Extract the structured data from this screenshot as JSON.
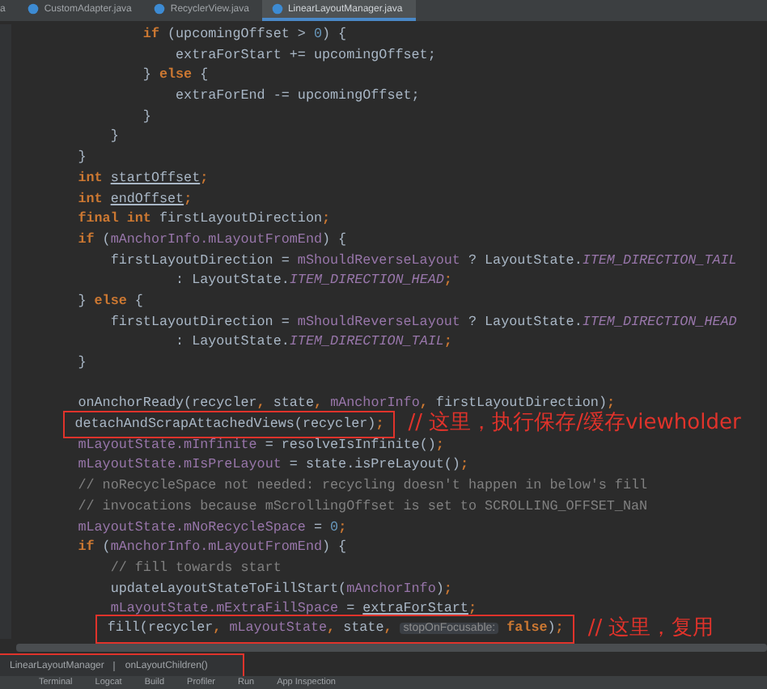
{
  "tabs": [
    {
      "label": "a",
      "selected": false
    },
    {
      "label": "CustomAdapter.java",
      "selected": false
    },
    {
      "label": "RecyclerView.java",
      "selected": false
    },
    {
      "label": "LinearLayoutManager.java",
      "selected": true
    }
  ],
  "code_lines": [
    {
      "kind": "code",
      "boxed": false,
      "segments": [
        {
          "kind": "keyword",
          "text": "                if "
        },
        {
          "kind": "plain",
          "text": "(upcomingOffset > "
        },
        {
          "kind": "number",
          "text": "0"
        },
        {
          "kind": "plain",
          "text": ") {"
        }
      ]
    },
    {
      "kind": "code",
      "boxed": false,
      "segments": [
        {
          "kind": "plain",
          "text": "                    extraForStart += upcomingOffset;"
        }
      ]
    },
    {
      "kind": "code",
      "boxed": false,
      "segments": [
        {
          "kind": "plain",
          "text": "                } "
        },
        {
          "kind": "keyword",
          "text": "else "
        },
        {
          "kind": "plain",
          "text": "{"
        }
      ]
    },
    {
      "kind": "code",
      "boxed": false,
      "segments": [
        {
          "kind": "plain",
          "text": "                    extraForEnd -= upcomingOffset;"
        }
      ]
    },
    {
      "kind": "code",
      "boxed": false,
      "segments": [
        {
          "kind": "plain",
          "text": "                }"
        }
      ]
    },
    {
      "kind": "code",
      "boxed": false,
      "segments": [
        {
          "kind": "plain",
          "text": "            }"
        }
      ]
    },
    {
      "kind": "code",
      "boxed": false,
      "segments": [
        {
          "kind": "plain",
          "text": "        }"
        }
      ]
    },
    {
      "kind": "code",
      "boxed": false,
      "segments": [
        {
          "kind": "keyword",
          "text": "        int "
        },
        {
          "kind": "underlined",
          "text": "startOffset"
        },
        {
          "kind": "keyword",
          "text": ";"
        }
      ]
    },
    {
      "kind": "code",
      "boxed": false,
      "segments": [
        {
          "kind": "keyword",
          "text": "        int "
        },
        {
          "kind": "underlined",
          "text": "endOffset"
        },
        {
          "kind": "keyword",
          "text": ";"
        }
      ]
    },
    {
      "kind": "code",
      "boxed": false,
      "segments": [
        {
          "kind": "keyword",
          "text": "        final int "
        },
        {
          "kind": "plain",
          "text": "firstLayoutDirection"
        },
        {
          "kind": "keyword",
          "text": ";"
        }
      ]
    },
    {
      "kind": "code",
      "boxed": false,
      "segments": [
        {
          "kind": "keyword",
          "text": "        if "
        },
        {
          "kind": "plain",
          "text": "("
        },
        {
          "kind": "field",
          "text": "mAnchorInfo.mLayoutFromEnd"
        },
        {
          "kind": "plain",
          "text": ") {"
        }
      ]
    },
    {
      "kind": "code",
      "boxed": false,
      "segments": [
        {
          "kind": "plain",
          "text": "            firstLayoutDirection = "
        },
        {
          "kind": "field",
          "text": "mShouldReverseLayout"
        },
        {
          "kind": "plain",
          "text": " ? LayoutState."
        },
        {
          "kind": "constant",
          "text": "ITEM_DIRECTION_TAIL"
        }
      ]
    },
    {
      "kind": "code",
      "boxed": false,
      "segments": [
        {
          "kind": "plain",
          "text": "                    : LayoutState."
        },
        {
          "kind": "constant",
          "text": "ITEM_DIRECTION_HEAD"
        },
        {
          "kind": "keyword",
          "text": ";"
        }
      ]
    },
    {
      "kind": "code",
      "boxed": false,
      "segments": [
        {
          "kind": "plain",
          "text": "        } "
        },
        {
          "kind": "keyword",
          "text": "else "
        },
        {
          "kind": "plain",
          "text": "{"
        }
      ]
    },
    {
      "kind": "code",
      "boxed": false,
      "segments": [
        {
          "kind": "plain",
          "text": "            firstLayoutDirection = "
        },
        {
          "kind": "field",
          "text": "mShouldReverseLayout"
        },
        {
          "kind": "plain",
          "text": " ? LayoutState."
        },
        {
          "kind": "constant",
          "text": "ITEM_DIRECTION_HEAD"
        }
      ]
    },
    {
      "kind": "code",
      "boxed": false,
      "segments": [
        {
          "kind": "plain",
          "text": "                    : LayoutState."
        },
        {
          "kind": "constant",
          "text": "ITEM_DIRECTION_TAIL"
        },
        {
          "kind": "keyword",
          "text": ";"
        }
      ]
    },
    {
      "kind": "code",
      "boxed": false,
      "segments": [
        {
          "kind": "plain",
          "text": "        }"
        }
      ]
    },
    {
      "kind": "blank"
    },
    {
      "kind": "code",
      "boxed": false,
      "segments": [
        {
          "kind": "plain",
          "text": "        onAnchorReady(recycler"
        },
        {
          "kind": "keyword",
          "text": ", "
        },
        {
          "kind": "plain",
          "text": "state"
        },
        {
          "kind": "keyword",
          "text": ", "
        },
        {
          "kind": "field",
          "text": "mAnchorInfo"
        },
        {
          "kind": "keyword",
          "text": ", "
        },
        {
          "kind": "plain",
          "text": "firstLayoutDirection)"
        },
        {
          "kind": "keyword",
          "text": ";"
        }
      ]
    },
    {
      "kind": "code",
      "boxed": true,
      "note": "// 这里，执行保存/缓存viewholder",
      "segments": [
        {
          "kind": "plain",
          "text": "        detachAndScrapAttachedViews(recycler)"
        },
        {
          "kind": "keyword",
          "text": ";"
        }
      ]
    },
    {
      "kind": "code",
      "boxed": false,
      "segments": [
        {
          "kind": "field",
          "text": "        mLayoutState.mInfinite"
        },
        {
          "kind": "plain",
          "text": " = resolveIsInfinite()"
        },
        {
          "kind": "keyword",
          "text": ";"
        }
      ]
    },
    {
      "kind": "code",
      "boxed": false,
      "segments": [
        {
          "kind": "field",
          "text": "        mLayoutState.mIsPreLayout"
        },
        {
          "kind": "plain",
          "text": " = state.isPreLayout()"
        },
        {
          "kind": "keyword",
          "text": ";"
        }
      ]
    },
    {
      "kind": "code",
      "boxed": false,
      "segments": [
        {
          "kind": "comment",
          "text": "        // noRecycleSpace not needed: recycling doesn't happen in below's fill"
        }
      ]
    },
    {
      "kind": "code",
      "boxed": false,
      "segments": [
        {
          "kind": "comment",
          "text": "        // invocations because mScrollingOffset is set to SCROLLING_OFFSET_NaN"
        }
      ]
    },
    {
      "kind": "code",
      "boxed": false,
      "segments": [
        {
          "kind": "field",
          "text": "        mLayoutState.mNoRecycleSpace"
        },
        {
          "kind": "plain",
          "text": " = "
        },
        {
          "kind": "number",
          "text": "0"
        },
        {
          "kind": "keyword",
          "text": ";"
        }
      ]
    },
    {
      "kind": "code",
      "boxed": false,
      "segments": [
        {
          "kind": "keyword",
          "text": "        if "
        },
        {
          "kind": "plain",
          "text": "("
        },
        {
          "kind": "field",
          "text": "mAnchorInfo.mLayoutFromEnd"
        },
        {
          "kind": "plain",
          "text": ") {"
        }
      ]
    },
    {
      "kind": "code",
      "boxed": false,
      "segments": [
        {
          "kind": "comment",
          "text": "            // fill towards start"
        }
      ]
    },
    {
      "kind": "code",
      "boxed": false,
      "segments": [
        {
          "kind": "plain",
          "text": "            updateLayoutStateToFillStart("
        },
        {
          "kind": "field",
          "text": "mAnchorInfo"
        },
        {
          "kind": "plain",
          "text": ")"
        },
        {
          "kind": "keyword",
          "text": ";"
        }
      ]
    },
    {
      "kind": "code",
      "boxed": false,
      "segments": [
        {
          "kind": "field",
          "text": "            mLayoutState.mExtraFillSpace"
        },
        {
          "kind": "plain",
          "text": " = "
        },
        {
          "kind": "underlined",
          "text": "extraForStart"
        },
        {
          "kind": "keyword",
          "text": ";"
        }
      ]
    },
    {
      "kind": "code",
      "boxed": true,
      "note": "// 这里，复用",
      "segments": [
        {
          "kind": "plain",
          "text": "            fill(recycler"
        },
        {
          "kind": "keyword",
          "text": ", "
        },
        {
          "kind": "field",
          "text": "mLayoutState"
        },
        {
          "kind": "keyword",
          "text": ", "
        },
        {
          "kind": "plain",
          "text": "state"
        },
        {
          "kind": "keyword",
          "text": ", "
        },
        {
          "kind": "hint",
          "text": "stopOnFocusable:"
        },
        {
          "kind": "keyword",
          "text": " false"
        },
        {
          "kind": "plain",
          "text": ")"
        },
        {
          "kind": "keyword",
          "text": ";"
        }
      ]
    }
  ],
  "breadcrumbs": [
    "LinearLayoutManager",
    "onLayoutChildren()"
  ],
  "tool_windows": [
    "Terminal",
    "Logcat",
    "Build",
    "Profiler",
    "Run",
    "App Inspection"
  ]
}
